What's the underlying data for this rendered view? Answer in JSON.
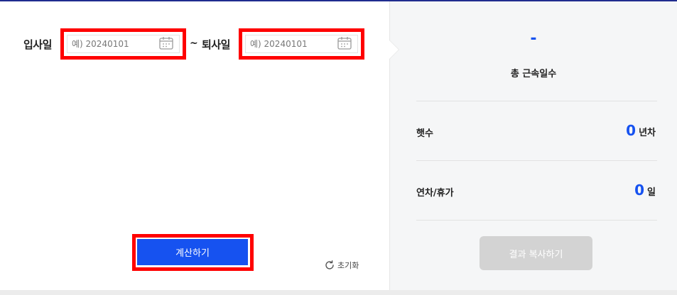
{
  "form": {
    "start_label": "입사일",
    "end_label": "퇴사일",
    "start_placeholder": "예) 20240101",
    "end_placeholder": "예) 20240101",
    "separator": "~",
    "calc_button": "계산하기",
    "reset_label": "초기화"
  },
  "result": {
    "total_value": "-",
    "total_label": "총 근속일수",
    "years_label": "햇수",
    "years_value": "0",
    "years_unit": "년차",
    "leave_label": "연차/휴가",
    "leave_value": "0",
    "leave_unit": "일",
    "copy_button": "결과 복사하기"
  },
  "colors": {
    "accent": "#1652f0",
    "highlight": "#ff0000",
    "panel_bg": "#f5f6f7",
    "disabled_button": "#d3d3d3"
  },
  "icons": [
    "calendar-icon",
    "refresh-icon"
  ]
}
